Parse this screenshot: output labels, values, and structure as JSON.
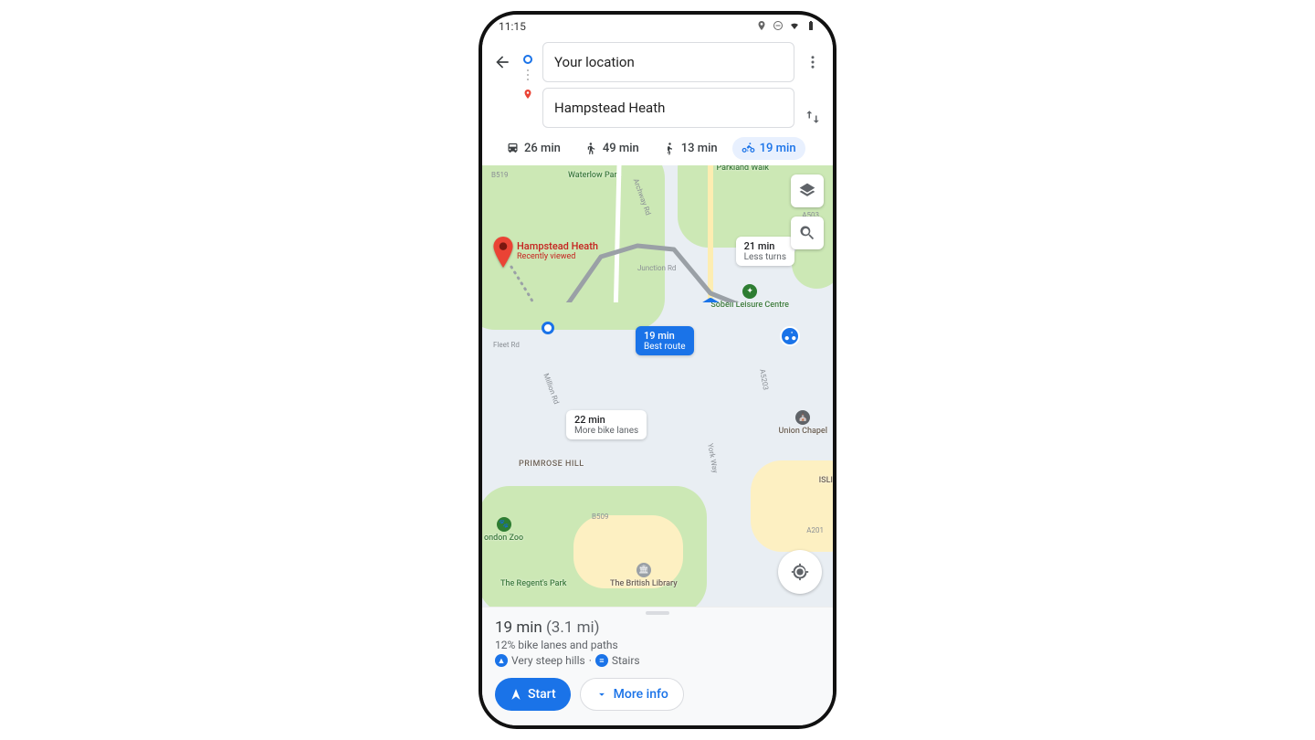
{
  "status": {
    "time": "11:15"
  },
  "directions": {
    "origin": "Your location",
    "destination": "Hampstead Heath",
    "destination_sub": "Recently viewed"
  },
  "modes": {
    "transit": "26 min",
    "walk": "49 min",
    "ride": "13 min",
    "bike": "19 min"
  },
  "routes": {
    "best": {
      "time": "19 min",
      "sub": "Best route"
    },
    "alt1": {
      "time": "21 min",
      "sub": "Less turns"
    },
    "alt2": {
      "time": "22 min",
      "sub": "More bike lanes"
    }
  },
  "pois": {
    "parkland": "Parkland Walk",
    "waterlow": "Waterlow Park",
    "sobell": "Sobell Leisure Centre",
    "primrose": "PRIMROSE HILL",
    "regents": "The Regent's Park",
    "bl": "The British Library",
    "union": "Union Chapel",
    "zoo": "ondon Zoo",
    "isl": "ISLI"
  },
  "roads": {
    "a503": "A503",
    "b519": "B519",
    "b509": "B509",
    "fleet": "Fleet Rd",
    "million": "Million Rd",
    "york": "York Way",
    "junction": "Junction Rd",
    "archway": "Archway Rd",
    "a201": "A201",
    "a5203": "A5203"
  },
  "sheet": {
    "time": "19 min",
    "dist": "(3.1 mi)",
    "bike_lanes": "12% bike lanes and paths",
    "hills": "Very steep hills",
    "stairs": "Stairs",
    "start": "Start",
    "more": "More info"
  }
}
